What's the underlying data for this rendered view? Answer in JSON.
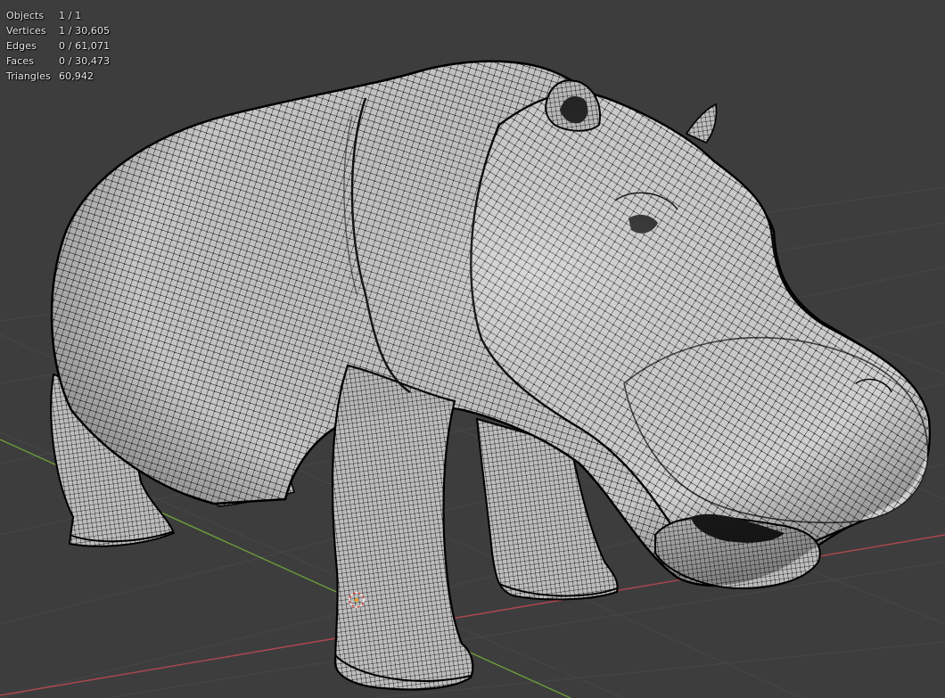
{
  "viewport": {
    "background": "#3d3d3d",
    "grid_color": "#474747",
    "x_axis_color": "#b0474f",
    "y_axis_color": "#6c9b3a"
  },
  "model": {
    "surface_color": "#c9c9c9",
    "wire_color": "#111111",
    "vertex_color": "#000000",
    "origin_marker_icon": "object-origin-icon"
  },
  "stats": [
    {
      "label": "Objects",
      "value": "1 / 1"
    },
    {
      "label": "Vertices",
      "value": "1 / 30,605"
    },
    {
      "label": "Edges",
      "value": "0 / 61,071"
    },
    {
      "label": "Faces",
      "value": "0 / 30,473"
    },
    {
      "label": "Triangles",
      "value": "60,942"
    }
  ]
}
